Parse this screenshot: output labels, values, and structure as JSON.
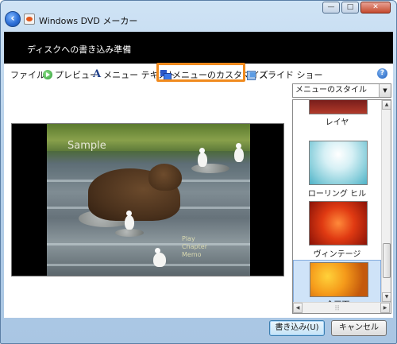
{
  "window": {
    "title": "Windows DVD メーカー",
    "back_icon": "back-arrow-icon",
    "controls": {
      "minimize": "—",
      "maximize": "□",
      "close": "✕"
    }
  },
  "banner": {
    "title": "ディスクへの書き込み準備"
  },
  "toolbar": {
    "items": [
      {
        "label": "ファイル"
      },
      {
        "label": "プレビュー",
        "icon": "play-icon"
      },
      {
        "label": "メニュー テキスト",
        "icon": "text-icon"
      },
      {
        "label": "メニューのカスタマイズ",
        "icon": "customize-icon",
        "highlight_color": "#f08a1e"
      },
      {
        "label": "スライド ショー",
        "icon": "slideshow-icon"
      }
    ],
    "help": "?"
  },
  "preview": {
    "overlay_title": "Sample",
    "menu_entries": [
      "Play",
      "Chapter",
      "Memo"
    ]
  },
  "styles": {
    "dropdown_value": "メニューのスタイル",
    "items": [
      {
        "label": "レイヤ"
      },
      {
        "label": "ローリング ヒル"
      },
      {
        "label": "ヴィンテージ"
      },
      {
        "label": "全画面",
        "selected": true
      }
    ],
    "hscroll_grip": "⦙⦙⦙"
  },
  "buttons": {
    "burn": "書き込み(U)",
    "cancel": "キャンセル"
  }
}
